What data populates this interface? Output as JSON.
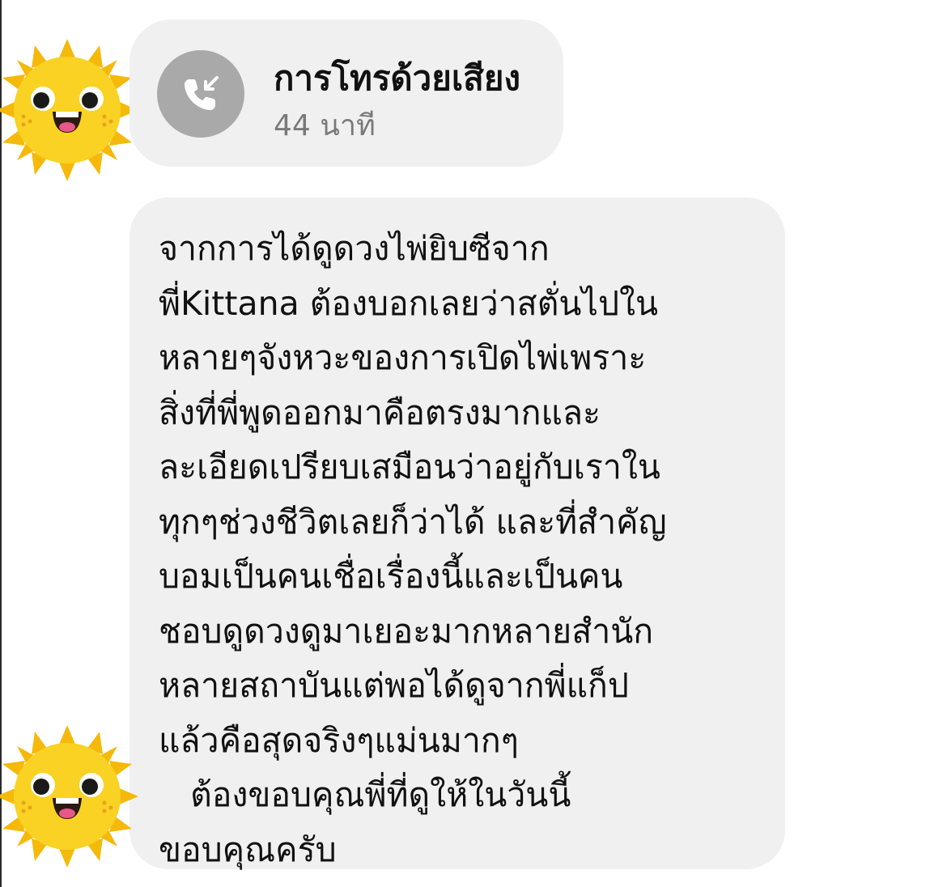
{
  "call": {
    "title": "การโทรด้วยเสียง",
    "duration": "44 นาที",
    "icon": "incoming-call-icon"
  },
  "message": {
    "lines": [
      "จากการได้ดูดวงไพ่ยิบซีจาก",
      "พี่Kittana ต้องบอกเลยว่าสตั่นไปใน",
      "หลายๆจังหวะของการเปิดไพ่เพราะ",
      "สิ่งที่พี่พูดออกมาคือตรงมากและ",
      "ละเอียดเปรียบเสมือนว่าอยู่กับเราใน",
      "ทุกๆช่วงชีวิตเลยก็ว่าได้ และที่สำคัญ",
      "บอมเป็นคนเชื่อเรื่องนี้และเป็นคน",
      "ชอบดูดวงดูมาเยอะมากหลายสำนัก",
      "หลายสถาบันแต่พอได้ดูจากพี่แก็ป",
      "แล้วคือสุดจริงๆแม่นมากๆ",
      "   ต้องขอบคุณพี่ที่ดูให้ในวันนี้",
      "ขอบคุณครับ"
    ]
  },
  "avatars": {
    "icon": "sun-emoji-avatar",
    "face_color": "#f9d223",
    "ray_color": "#f5b90b"
  },
  "colors": {
    "bubble_bg": "#f0f0f0",
    "call_icon_bg": "#a9a9a9",
    "text": "#111111",
    "subtext": "#7a7a7a"
  }
}
